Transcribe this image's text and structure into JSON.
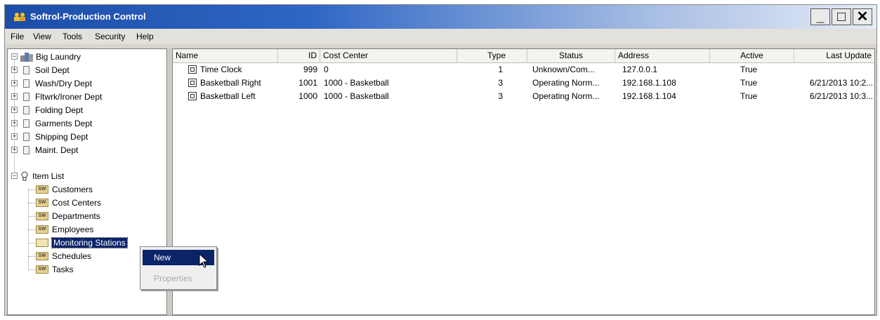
{
  "window": {
    "title": "Softrol-Production Control",
    "buttons": {
      "minimize": "_",
      "maximize": "□",
      "close": "✕"
    }
  },
  "menubar": {
    "items": [
      "File",
      "View",
      "Tools",
      "Security",
      "Help"
    ]
  },
  "tree": {
    "root": "Big Laundry",
    "departments": [
      "Soil Dept",
      "Wash/Dry Dept",
      "Fltwrk/Ironer Dept",
      "Folding Dept",
      "Garments Dept",
      "Shipping Dept",
      "Maint. Dept"
    ],
    "item_list_label": "Item List",
    "item_list": [
      "Customers",
      "Cost Centers",
      "Departments",
      "Employees",
      "Monitoring Stations",
      "Schedules",
      "Tasks"
    ],
    "selected": "Monitoring Stations"
  },
  "table": {
    "columns": [
      "Name",
      "ID",
      "Cost Center",
      "Type",
      "Status",
      "Address",
      "Active",
      "Last Update"
    ],
    "rows": [
      {
        "name": "Time Clock",
        "id": "999",
        "cost_center": "0",
        "type": "1",
        "status": "Unknown/Com...",
        "address": "127.0.0.1",
        "active": "True",
        "last_update": ""
      },
      {
        "name": "Basketball Right",
        "id": "1001",
        "cost_center": "1000 - Basketball",
        "type": "3",
        "status": "Operating Norm...",
        "address": "192.168.1.108",
        "active": "True",
        "last_update": "6/21/2013 10:2..."
      },
      {
        "name": "Basketball Left",
        "id": "1000",
        "cost_center": "1000 - Basketball",
        "type": "3",
        "status": "Operating Norm...",
        "address": "192.168.1.104",
        "active": "True",
        "last_update": "6/21/2013 10:3..."
      }
    ]
  },
  "context_menu": {
    "new_label": "New",
    "properties_label": "Properties"
  },
  "colors": {
    "title_start": "#1c4ea8",
    "selection": "#0a246a",
    "window_bg": "#d8d5cc"
  }
}
